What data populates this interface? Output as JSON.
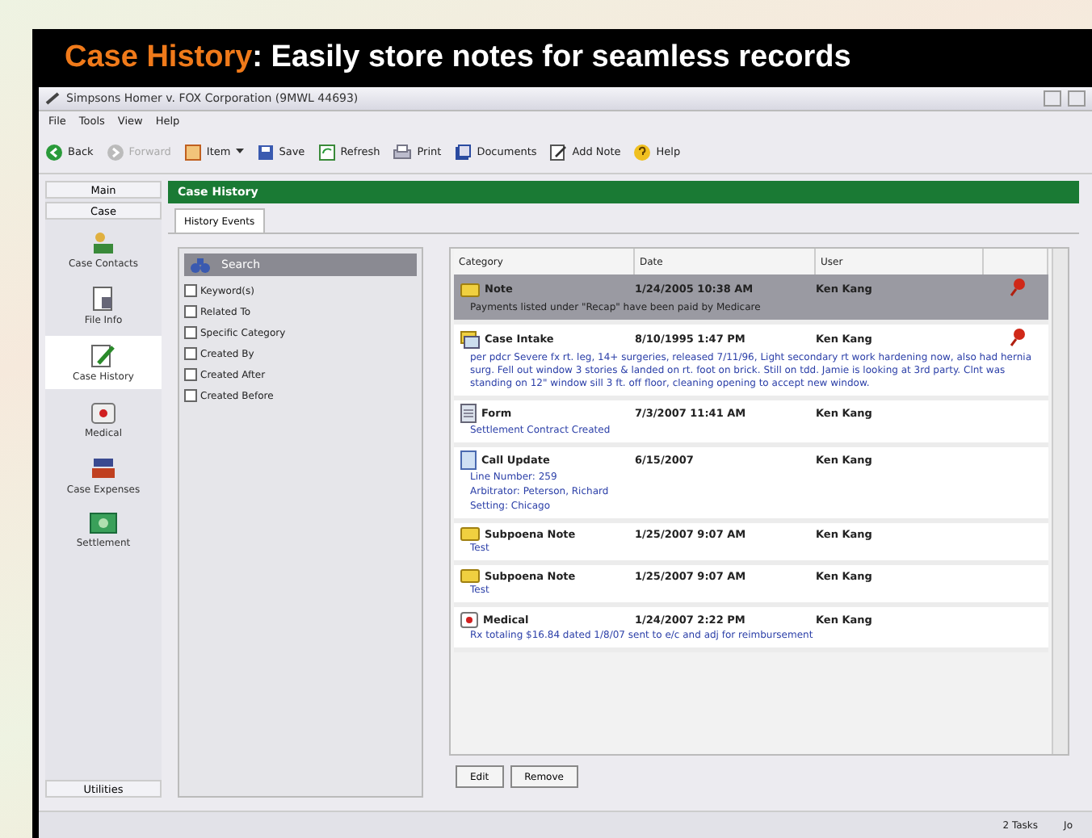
{
  "banner": {
    "highlight": "Case History",
    "text": ": Easily store notes for seamless records"
  },
  "window": {
    "title": "Simpsons Homer v. FOX Corporation (9MWL 44693)"
  },
  "menu": [
    "File",
    "Tools",
    "View",
    "Help"
  ],
  "toolbar": [
    {
      "label": "Back",
      "kind": "back",
      "disabled": false
    },
    {
      "label": "Forward",
      "kind": "forward",
      "disabled": true
    },
    {
      "label": "Item",
      "kind": "item",
      "disabled": false,
      "dropdown": true
    },
    {
      "label": "Save",
      "kind": "save",
      "disabled": false
    },
    {
      "label": "Refresh",
      "kind": "refresh",
      "disabled": false
    },
    {
      "label": "Print",
      "kind": "print",
      "disabled": false
    },
    {
      "label": "Documents",
      "kind": "documents",
      "disabled": false
    },
    {
      "label": "Add Note",
      "kind": "note",
      "disabled": false
    },
    {
      "label": "Help",
      "kind": "help",
      "disabled": false
    }
  ],
  "sidebar": {
    "top": [
      "Main",
      "Case"
    ],
    "items": [
      {
        "label": "Case Contacts",
        "kind": "contacts",
        "selected": false
      },
      {
        "label": "File Info",
        "kind": "file",
        "selected": false
      },
      {
        "label": "Case History",
        "kind": "history",
        "selected": true
      },
      {
        "label": "Medical",
        "kind": "medical",
        "selected": false
      },
      {
        "label": "Case Expenses",
        "kind": "expenses",
        "selected": false
      },
      {
        "label": "Settlement",
        "kind": "settlement",
        "selected": false
      }
    ],
    "bottom": "Utilities"
  },
  "section_title": "Case History",
  "tabs": [
    {
      "label": "History Events",
      "selected": true
    }
  ],
  "search": {
    "title": "Search",
    "filters": [
      {
        "label": "Keyword(s)",
        "checked": false
      },
      {
        "label": "Related To",
        "checked": false
      },
      {
        "label": "Specific Category",
        "checked": false
      },
      {
        "label": "Created By",
        "checked": false
      },
      {
        "label": "Created After",
        "checked": false
      },
      {
        "label": "Created Before",
        "checked": false
      }
    ]
  },
  "table": {
    "columns": [
      "Category",
      "Date",
      "User"
    ],
    "rows": [
      {
        "kind": "note",
        "category": "Note",
        "date": "1/24/2005 10:38 AM",
        "user": "Ken Kang",
        "pinned": true,
        "selected": true,
        "lines": [
          "Payments listed under \"Recap\" have been paid by Medicare"
        ]
      },
      {
        "kind": "intake",
        "category": "Case Intake",
        "date": "8/10/1995 1:47 PM",
        "user": "Ken Kang",
        "pinned": true,
        "selected": false,
        "lines": [
          "per pdcr Severe fx rt. leg, 14+ surgeries, released 7/11/96, Light secondary rt work hardening now, also had hernia surg. Fell out window 3 stories & landed on rt. foot on brick. Still on tdd. Jamie is looking at 3rd party. Clnt was standing on 12\" window sill 3 ft. off floor, cleaning opening to accept new window."
        ]
      },
      {
        "kind": "form",
        "category": "Form",
        "date": "7/3/2007 11:41 AM",
        "user": "Ken Kang",
        "pinned": false,
        "selected": false,
        "lines": [
          "Settlement Contract Created"
        ]
      },
      {
        "kind": "call",
        "category": "Call Update",
        "date": "6/15/2007",
        "user": "Ken Kang",
        "pinned": false,
        "selected": false,
        "lines": [
          "Line Number: 259",
          "Arbitrator: Peterson, Richard",
          "Setting: Chicago"
        ]
      },
      {
        "kind": "note",
        "category": "Subpoena Note",
        "date": "1/25/2007 9:07 AM",
        "user": "Ken Kang",
        "pinned": false,
        "selected": false,
        "lines": [
          "Test"
        ]
      },
      {
        "kind": "note",
        "category": "Subpoena Note",
        "date": "1/25/2007 9:07 AM",
        "user": "Ken Kang",
        "pinned": false,
        "selected": false,
        "lines": [
          "Test"
        ]
      },
      {
        "kind": "medical",
        "category": "Medical",
        "date": "1/24/2007 2:22 PM",
        "user": "Ken Kang",
        "pinned": false,
        "selected": false,
        "lines": [
          "Rx totaling $16.84 dated 1/8/07 sent to e/c and adj for reimbursement"
        ]
      }
    ]
  },
  "actions": [
    "Edit",
    "Remove"
  ],
  "status_bar": [
    "2 Tasks",
    "Jo"
  ]
}
